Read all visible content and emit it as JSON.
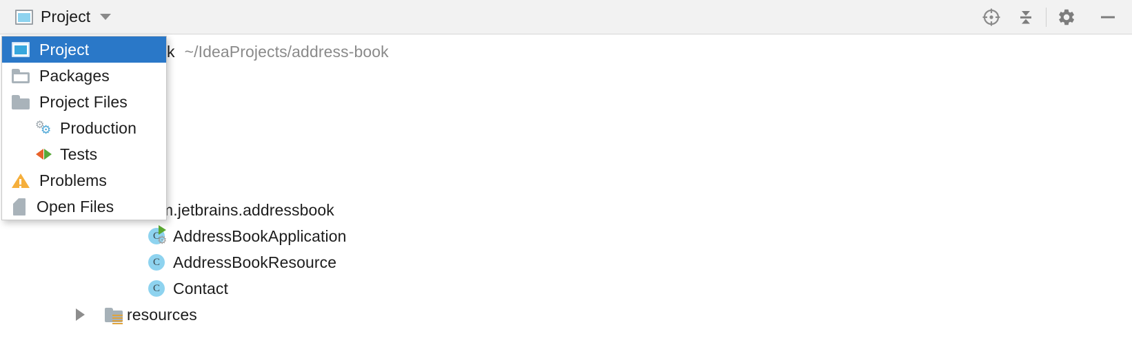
{
  "toolbar": {
    "title": "Project",
    "window_icon": "project-window-icon",
    "dropdown_caret": "chevron-down-icon",
    "actions": [
      {
        "name": "scroll-from-source-icon",
        "label": "Select Opened File"
      },
      {
        "name": "collapse-all-icon",
        "label": "Collapse All"
      },
      {
        "name": "gear-icon",
        "label": "Options"
      },
      {
        "name": "minimize-icon",
        "label": "Hide"
      }
    ]
  },
  "popup": {
    "items": [
      {
        "label": "Project",
        "icon": "project-window-icon",
        "selected": true,
        "indent": false
      },
      {
        "label": "Packages",
        "icon": "folder-outline-icon",
        "selected": false,
        "indent": false
      },
      {
        "label": "Project Files",
        "icon": "folder-icon",
        "selected": false,
        "indent": false
      },
      {
        "label": "Production",
        "icon": "gears-icon",
        "selected": false,
        "indent": true
      },
      {
        "label": "Tests",
        "icon": "tests-arrows-icon",
        "selected": false,
        "indent": true
      },
      {
        "label": "Problems",
        "icon": "warning-triangle-icon",
        "selected": false,
        "indent": false
      },
      {
        "label": "Open Files",
        "icon": "document-icon",
        "selected": false,
        "indent": false
      }
    ]
  },
  "tree": {
    "rows": [
      {
        "name": "address-book",
        "visible_text": "k",
        "path": "~/IdeaProjects/address-book",
        "icon": "none",
        "arrow": false
      },
      {
        "name": "com.jetbrains.addressbook",
        "visible_text": "m.jetbrains.addressbook",
        "path": "",
        "icon": "none",
        "arrow": false
      },
      {
        "name": "AddressBookApplication",
        "visible_text": "AddressBookApplication",
        "path": "",
        "icon": "class-runnable-icon",
        "arrow": false
      },
      {
        "name": "AddressBookResource",
        "visible_text": "AddressBookResource",
        "path": "",
        "icon": "class-icon",
        "arrow": false
      },
      {
        "name": "Contact",
        "visible_text": "Contact",
        "path": "",
        "icon": "class-icon",
        "arrow": false
      },
      {
        "name": "resources",
        "visible_text": "resources",
        "path": "",
        "icon": "resources-folder-icon",
        "arrow": true
      }
    ]
  },
  "colors": {
    "selection_blue": "#2a78c8",
    "toolbar_bg": "#f2f2f2",
    "content_bg": "#ffffff",
    "class_icon": "#8ed3ef",
    "warning_orange": "#f5af3c",
    "test_orange": "#e8622a",
    "test_green": "#59a83a",
    "folder_gray": "#a9b3ba",
    "path_text": "#8a8a8a"
  }
}
